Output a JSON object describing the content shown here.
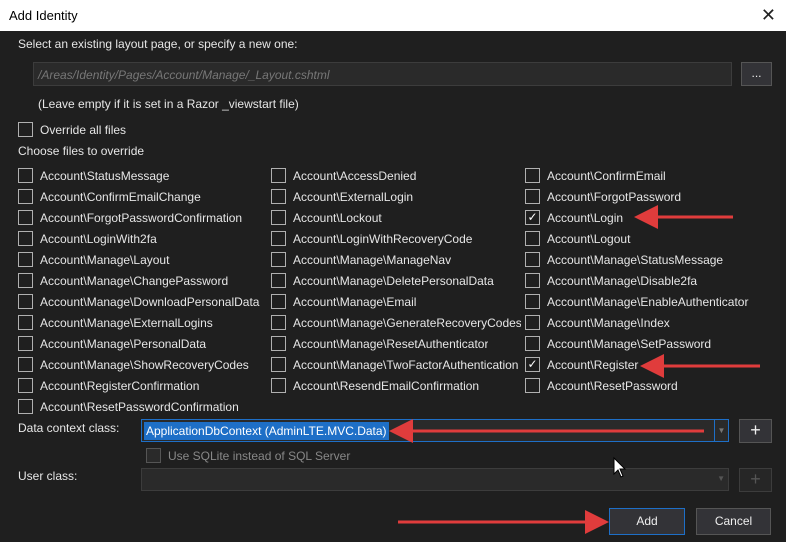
{
  "window": {
    "title": "Add Identity",
    "close": "✕"
  },
  "layout": {
    "label": "Select an existing layout page, or specify a new one:",
    "value": "/Areas/Identity/Pages/Account/Manage/_Layout.cshtml",
    "browse": "...",
    "hint": "(Leave empty if it is set in a Razor _viewstart file)"
  },
  "override_all": {
    "label": "Override all files",
    "checked": false
  },
  "choose_label": "Choose files to override",
  "files": [
    [
      "Account\\StatusMessage",
      false
    ],
    [
      "Account\\AccessDenied",
      false
    ],
    [
      "Account\\ConfirmEmail",
      false
    ],
    [
      "Account\\ConfirmEmailChange",
      false
    ],
    [
      "Account\\ExternalLogin",
      false
    ],
    [
      "Account\\ForgotPassword",
      false
    ],
    [
      "Account\\ForgotPasswordConfirmation",
      false
    ],
    [
      "Account\\Lockout",
      false
    ],
    [
      "Account\\Login",
      true
    ],
    [
      "Account\\LoginWith2fa",
      false
    ],
    [
      "Account\\LoginWithRecoveryCode",
      false
    ],
    [
      "Account\\Logout",
      false
    ],
    [
      "Account\\Manage\\Layout",
      false
    ],
    [
      "Account\\Manage\\ManageNav",
      false
    ],
    [
      "Account\\Manage\\StatusMessage",
      false
    ],
    [
      "Account\\Manage\\ChangePassword",
      false
    ],
    [
      "Account\\Manage\\DeletePersonalData",
      false
    ],
    [
      "Account\\Manage\\Disable2fa",
      false
    ],
    [
      "Account\\Manage\\DownloadPersonalData",
      false
    ],
    [
      "Account\\Manage\\Email",
      false
    ],
    [
      "Account\\Manage\\EnableAuthenticator",
      false
    ],
    [
      "Account\\Manage\\ExternalLogins",
      false
    ],
    [
      "Account\\Manage\\GenerateRecoveryCodes",
      false
    ],
    [
      "Account\\Manage\\Index",
      false
    ],
    [
      "Account\\Manage\\PersonalData",
      false
    ],
    [
      "Account\\Manage\\ResetAuthenticator",
      false
    ],
    [
      "Account\\Manage\\SetPassword",
      false
    ],
    [
      "Account\\Manage\\ShowRecoveryCodes",
      false
    ],
    [
      "Account\\Manage\\TwoFactorAuthentication",
      false
    ],
    [
      "Account\\Register",
      true
    ],
    [
      "Account\\RegisterConfirmation",
      false
    ],
    [
      "Account\\ResendEmailConfirmation",
      false
    ],
    [
      "Account\\ResetPassword",
      false
    ],
    [
      "Account\\ResetPasswordConfirmation",
      false
    ]
  ],
  "data_context": {
    "label": "Data context class:",
    "value": "ApplicationDbContext (AdminLTE.MVC.Data)",
    "add": "+"
  },
  "sqlite": {
    "label": "Use SQLite instead of SQL Server",
    "checked": false
  },
  "user_class": {
    "label": "User class:",
    "value": "",
    "add": "+"
  },
  "buttons": {
    "add": "Add",
    "cancel": "Cancel"
  },
  "colors": {
    "accent": "#1e6fc7",
    "arrow": "#e03c3c",
    "background": "#1f1f1f"
  }
}
